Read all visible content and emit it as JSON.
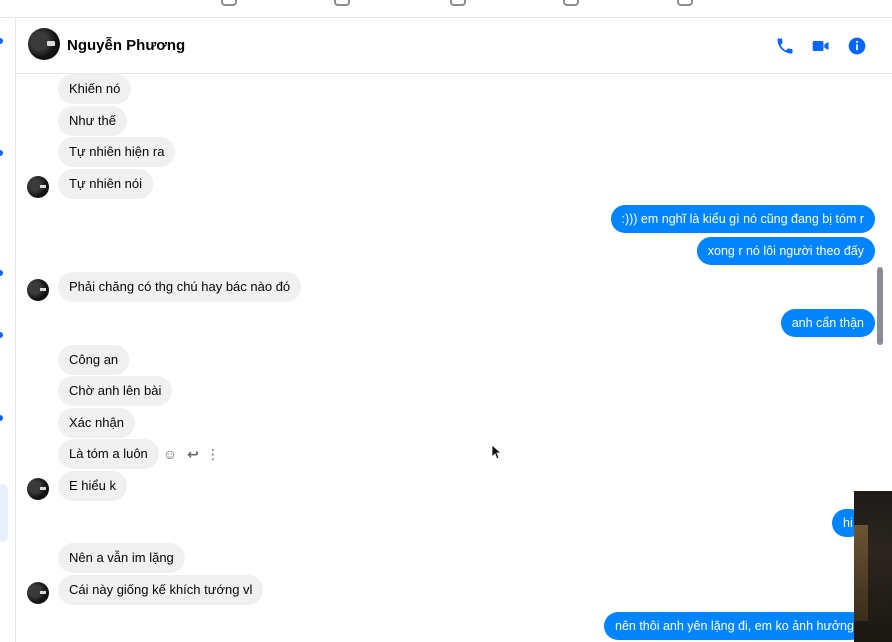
{
  "header": {
    "contact_name": "Nguyễn Phương",
    "icons": [
      "phone-icon",
      "video-camera-icon",
      "info-icon"
    ]
  },
  "messages": {
    "m1": "Khiến nó",
    "m2": "Như thế",
    "m3": "Tự nhiên hiện ra",
    "m4": "Tự nhiên nói",
    "m5": ":))) em nghĩ là kiểu gì nó cũng đang bị tóm r",
    "m6": "xong r nó lôi người theo đấy",
    "m7": "Phải chăng có thg chú hay bác nào đó",
    "m8": "anh cẩn thận",
    "m9": "Công an",
    "m10": "Chờ anh lên bài",
    "m11": "Xác nhận",
    "m12": "Là tóm a luôn",
    "m13": "E hiểu k",
    "m14": "hi",
    "m15": "Nên a vẫn im lặng",
    "m16": "Cái này giống kế khích tướng vl",
    "m17": "nên thôi anh yên lặng đi, em ko ảnh hưởng"
  },
  "message_actions": {
    "react_icon": "☺",
    "reply_icon": "↩",
    "more_icon": "⋮"
  },
  "colors": {
    "outgoing_bubble": "#0084ff",
    "incoming_bubble": "#f0f0f0",
    "accent": "#0866ff"
  }
}
